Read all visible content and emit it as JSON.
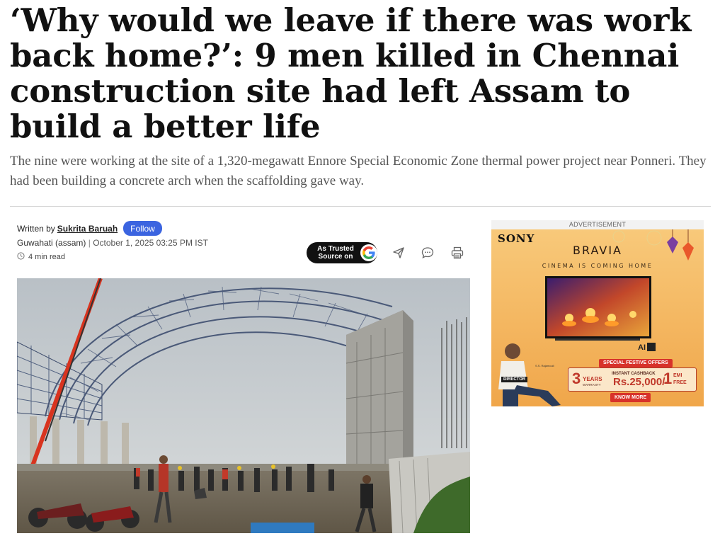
{
  "article": {
    "headline": "‘Why would we leave if there was work back home?’: 9 men killed in Chennai construction site had left Assam to build a better life",
    "subheadline": "The nine were working at the site of a 1,320-megawatt Ennore Special Economic Zone thermal power project near Ponneri. They had been building a concrete arch when the scaffolding gave way."
  },
  "byline": {
    "written_by": "Written by",
    "author": "Sukrita Baruah",
    "follow_label": "Follow",
    "location": "Guwahati (assam)",
    "separator": "|",
    "date": "October 1, 2025 03:25 PM IST",
    "read_time": "4 min read"
  },
  "actions": {
    "trusted_source_line1": "As Trusted",
    "trusted_source_line2": "Source on",
    "icons": [
      "google-icon",
      "share-icon",
      "comment-icon",
      "print-icon"
    ]
  },
  "advertisement": {
    "label": "ADVERTISEMENT",
    "brand": "SONY",
    "product": "BRAVIA",
    "tagline": "CINEMA IS COMING HOME",
    "ai_badge": "AI",
    "special_offers": "SPECIAL FESTIVE OFFERS",
    "warranty_num": "3",
    "warranty_unit": "YEARS",
    "warranty_label": "WARRANTY",
    "cashback_label": "INSTANT CASHBACK",
    "cashback_value": "Rs.25,000/-",
    "emi_num": "1",
    "emi_label": "EMI",
    "emi_free": "FREE",
    "cta": "KNOW MORE",
    "director_tag": "DIRECTOR",
    "endorser": "S.S. Rajamouli",
    "colors": {
      "background": "#f5b55c",
      "accent": "#d8322a"
    }
  },
  "colors": {
    "follow_button": "#3b64e0",
    "headline": "#111111",
    "subheadline": "#555555"
  }
}
